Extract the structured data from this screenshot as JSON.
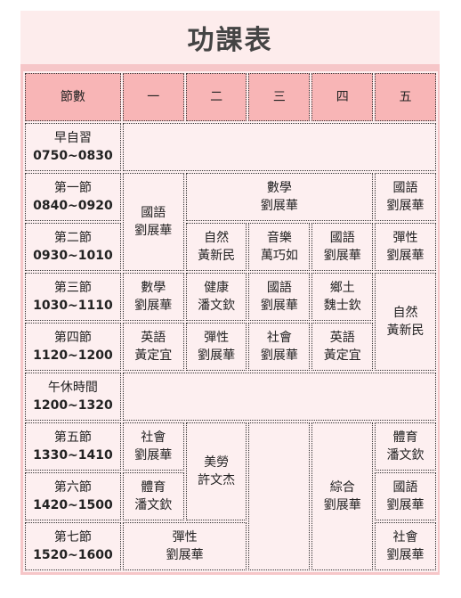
{
  "title": "功課表",
  "header": [
    "節數",
    "一",
    "二",
    "三",
    "四",
    "五"
  ],
  "periods": [
    {
      "name": "早自習",
      "time": "0750~0830"
    },
    {
      "name": "第一節",
      "time": "0840~0920"
    },
    {
      "name": "第二節",
      "time": "0930~1010"
    },
    {
      "name": "第三節",
      "time": "1030~1110"
    },
    {
      "name": "第四節",
      "time": "1120~1200"
    },
    {
      "name": "午休時間",
      "time": "1200~1320"
    },
    {
      "name": "第五節",
      "time": "1330~1410"
    },
    {
      "name": "第六節",
      "time": "1420~1500"
    },
    {
      "name": "第七節",
      "time": "1520~1600"
    }
  ],
  "cells": {
    "mon_p1_p2": {
      "subject": "國語",
      "teacher": "劉展華"
    },
    "tue_wed_thu_p1": {
      "subject": "數學",
      "teacher": "劉展華"
    },
    "fri_p1": {
      "subject": "國語",
      "teacher": "劉展華"
    },
    "tue_p2": {
      "subject": "自然",
      "teacher": "黃新民"
    },
    "wed_p2": {
      "subject": "音樂",
      "teacher": "萬巧如"
    },
    "thu_p2": {
      "subject": "國語",
      "teacher": "劉展華"
    },
    "fri_p2": {
      "subject": "彈性",
      "teacher": "劉展華"
    },
    "mon_p3": {
      "subject": "數學",
      "teacher": "劉展華"
    },
    "tue_p3": {
      "subject": "健康",
      "teacher": "潘文欽"
    },
    "wed_p3": {
      "subject": "國語",
      "teacher": "劉展華"
    },
    "thu_p3": {
      "subject": "鄉土",
      "teacher": "魏士欽"
    },
    "fri_p3_p4": {
      "subject": "自然",
      "teacher": "黃新民"
    },
    "mon_p4": {
      "subject": "英語",
      "teacher": "黃定宜"
    },
    "tue_p4": {
      "subject": "彈性",
      "teacher": "劉展華"
    },
    "wed_p4": {
      "subject": "社會",
      "teacher": "劉展華"
    },
    "thu_p4": {
      "subject": "英語",
      "teacher": "黃定宜"
    },
    "mon_p5": {
      "subject": "社會",
      "teacher": "劉展華"
    },
    "tue_p5_p6": {
      "subject": "美勞",
      "teacher": "許文杰"
    },
    "thu_p5_p7": {
      "subject": "綜合",
      "teacher": "劉展華"
    },
    "fri_p5": {
      "subject": "體育",
      "teacher": "潘文欽"
    },
    "mon_p6": {
      "subject": "體育",
      "teacher": "潘文欽"
    },
    "fri_p6": {
      "subject": "國語",
      "teacher": "劉展華"
    },
    "mon_tue_p7": {
      "subject": "彈性",
      "teacher": "劉展華"
    },
    "fri_p7": {
      "subject": "社會",
      "teacher": "劉展華"
    }
  }
}
